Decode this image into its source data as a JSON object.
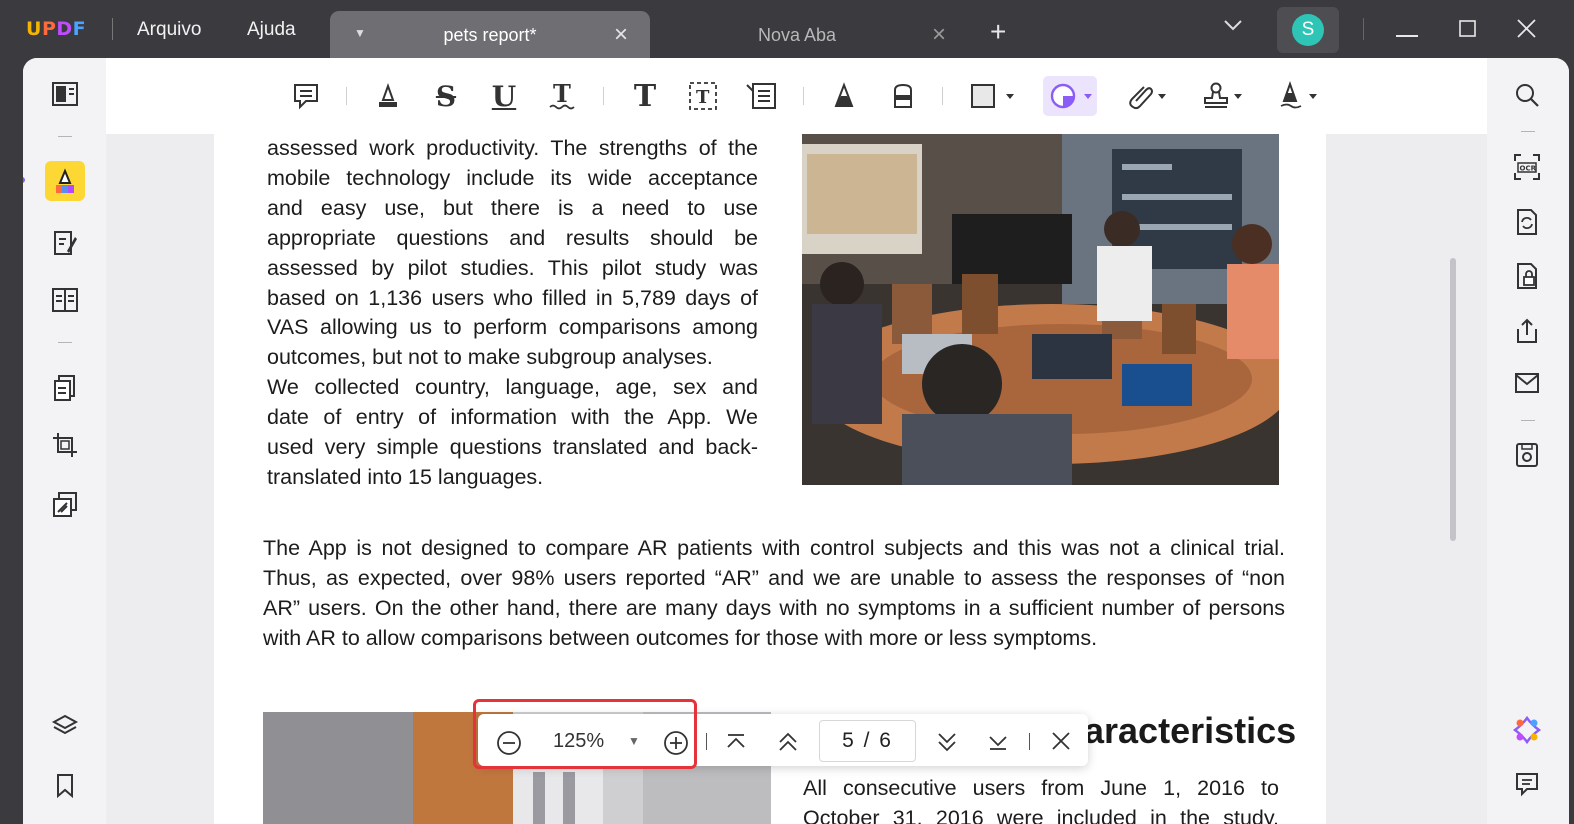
{
  "app": {
    "logo": "UPDF",
    "menu": [
      "Arquivo",
      "Ajuda"
    ],
    "tabs": [
      {
        "label": "pets report*",
        "active": true
      },
      {
        "label": "Nova Aba",
        "active": false
      }
    ],
    "avatar_initial": "S"
  },
  "colors": {
    "accent_purple": "#8b5cf6",
    "highlight_yellow": "#fdd835",
    "zoom_box_red": "#e5333a",
    "avatar_teal": "#2ec5b6"
  },
  "left_sidebar": [
    "reader-icon",
    "comment-icon",
    "edit-pdf-icon",
    "form-icon",
    "organize-pages-icon",
    "crop-icon",
    "protect-icon",
    "layers-icon",
    "bookmark-icon"
  ],
  "toolbar": [
    "comment",
    "highlight",
    "strikethrough",
    "underline",
    "squiggly",
    "text",
    "textbox",
    "text-callout",
    "pencil",
    "eraser",
    "shape",
    "sticker",
    "attachment",
    "stamp",
    "signature"
  ],
  "right_sidebar": [
    "search-icon",
    "ocr-icon",
    "convert-icon",
    "protect-icon",
    "share-icon",
    "email-icon",
    "save-icon",
    "ai-assistant-icon",
    "comments-panel-icon"
  ],
  "page": {
    "para1_lines": [
      "assessed work productivity. The strengths of the",
      "mobile technology include its wide acceptance",
      "and easy use, but there is a need to use",
      "appropriate questions and results should be",
      "assessed by pilot studies. This pilot study was",
      "based on 1,136 users who filled in 5,789 days of",
      "VAS allowing us to perform comparisons among",
      "outcomes, but not to make subgroup analyses.",
      "We collected country, language, age, sex and",
      "date of entry of information with the App. We",
      "used very simple questions translated and back-",
      "translated into 15 languages."
    ],
    "para2_lines": [
      "The App is not designed to compare AR patients with control subjects and this was not a clinical trial.",
      "Thus, as expected, over 98% users reported “AR” and we are unable to assess the responses of “non",
      "AR” users. On the other hand, there are many days with no symptoms in a sufficient number of persons",
      "with AR to allow comparisons between outcomes for those with more or less symptoms."
    ],
    "heading": "aracteristics",
    "para3_lines": [
      "All consecutive users from June 1, 2016 to",
      "October 31, 2016 were included in the study."
    ]
  },
  "navbar": {
    "zoom": "125%",
    "page_display": "5 / 6"
  }
}
